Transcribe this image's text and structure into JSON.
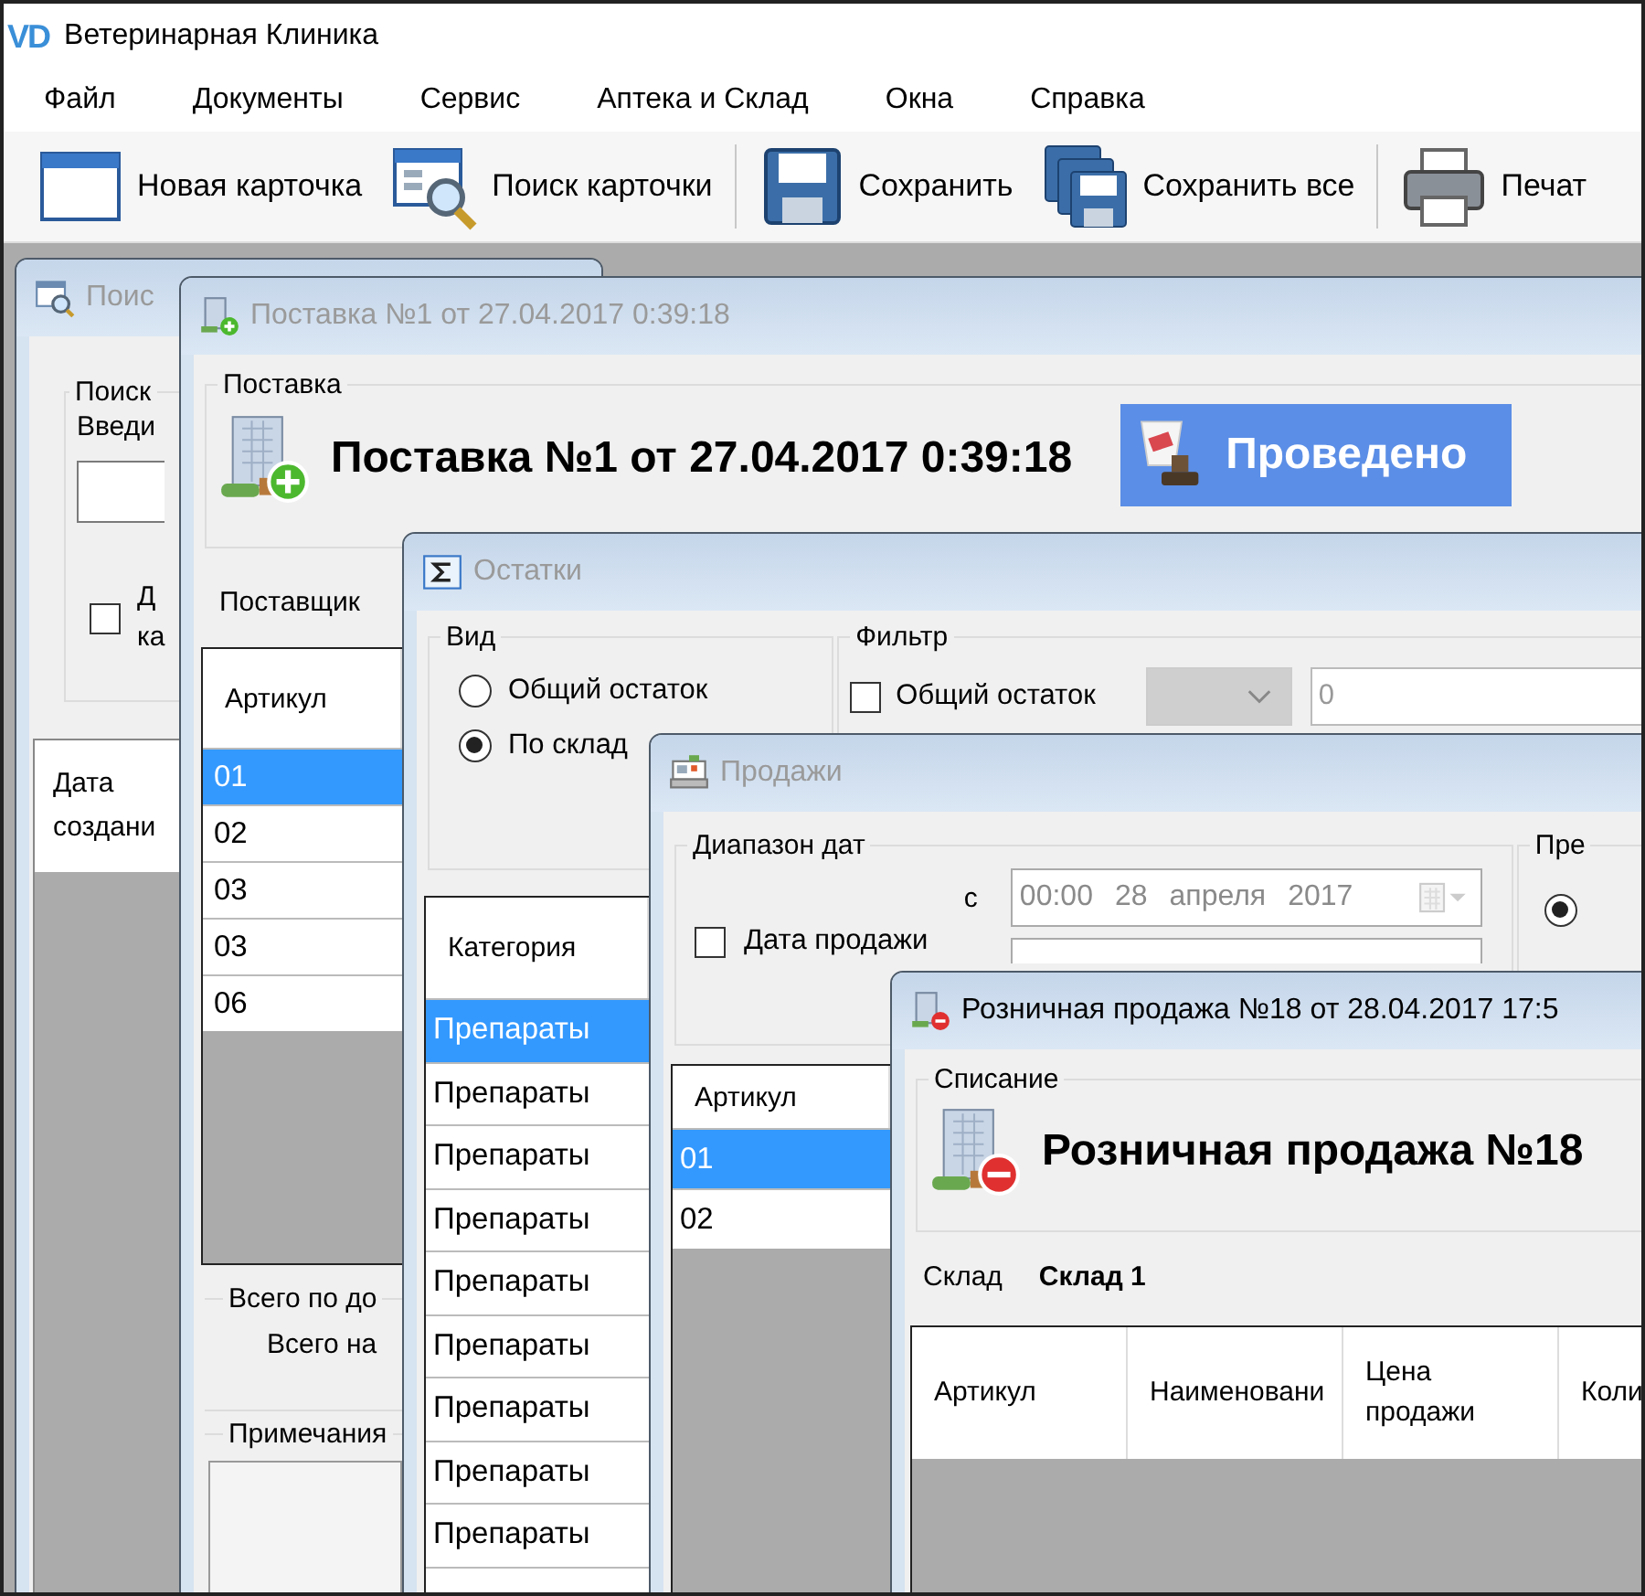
{
  "app": {
    "logo": "VD",
    "title": "Ветеринарная Клиника"
  },
  "menu": [
    "Файл",
    "Документы",
    "Сервис",
    "Аптека и Склад",
    "Окна",
    "Справка"
  ],
  "toolbar": [
    {
      "label": "Новая карточка",
      "kind": "card",
      "separator_before": false
    },
    {
      "label": "Поиск карточки",
      "kind": "search",
      "separator_before": false
    },
    {
      "label": "Сохранить",
      "kind": "save",
      "separator_before": true
    },
    {
      "label": "Сохранить все",
      "kind": "saveall",
      "separator_before": false
    },
    {
      "label": "Печат",
      "kind": "print",
      "separator_before": true
    }
  ],
  "search_window": {
    "title": "Поис",
    "active": false,
    "group": "Поиск",
    "prompt": "Введи",
    "checkbox": {
      "label_1": "Д",
      "label_2": "ка",
      "checked": false
    },
    "column": "Дата создани"
  },
  "delivery_window": {
    "title": "Поставка №1 от 27.04.2017 0:39:18",
    "active": false,
    "group": "Поставка",
    "heading": "Поставка №1 от 27.04.2017 0:39:18",
    "status": "Проведено",
    "supplier_label": "Поставщик",
    "column": "Артикул",
    "rows": [
      {
        "value": "01",
        "selected": true
      },
      {
        "value": "02",
        "selected": false
      },
      {
        "value": "03",
        "selected": false
      },
      {
        "value": "03",
        "selected": false
      },
      {
        "value": "06",
        "selected": false
      }
    ],
    "totals_group": "Всего по до",
    "totals_label": "Всего на",
    "notes_group": "Примечания"
  },
  "stock_window": {
    "title": "Остатки",
    "active": false,
    "view_group": "Вид",
    "view_options": [
      {
        "label": "Общий остаток",
        "selected": false
      },
      {
        "label": "По склад",
        "selected": true
      }
    ],
    "filter_group": "Фильтр",
    "filter_checkbox": {
      "label": "Общий остаток",
      "checked": false
    },
    "filter_combo": {
      "disabled": true
    },
    "filter_value": "0",
    "column": "Категория",
    "rows": [
      {
        "value": "Препараты",
        "selected": true
      },
      {
        "value": "Препараты",
        "selected": false
      },
      {
        "value": "Препараты",
        "selected": false
      },
      {
        "value": "Препараты",
        "selected": false
      },
      {
        "value": "Препараты",
        "selected": false
      },
      {
        "value": "Препараты",
        "selected": false
      },
      {
        "value": "Препараты",
        "selected": false
      },
      {
        "value": "Препараты",
        "selected": false
      },
      {
        "value": "Препараты",
        "selected": false
      }
    ]
  },
  "sales_window": {
    "title": "Продажи",
    "active": false,
    "date_group": "Диапазон дат",
    "date_checkbox": {
      "label": "Дата продажи",
      "checked": false
    },
    "from_label": "с",
    "from_date": {
      "time": "00:00",
      "day": "28",
      "month": "апреля",
      "year": "2017",
      "disabled": true
    },
    "side_group": "Пре",
    "side_radio": {
      "selected": true
    },
    "column": "Артикул",
    "rows": [
      {
        "value": "01",
        "selected": true
      },
      {
        "value": "02",
        "selected": false
      }
    ]
  },
  "retail_window": {
    "title": "Розничная продажа №18 от 28.04.2017 17:5",
    "active": true,
    "group": "Списание",
    "heading": "Розничная продажа №18",
    "warehouse_label": "Склад",
    "warehouse": "Склад 1",
    "columns": [
      "Артикул",
      "Наименовани",
      "Цена продажи",
      "Коли"
    ]
  }
}
